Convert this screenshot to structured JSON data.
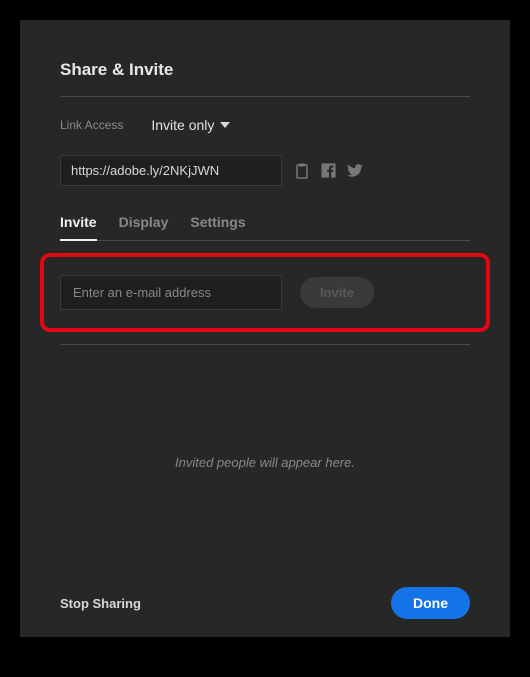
{
  "title": "Share & Invite",
  "linkAccess": {
    "label": "Link Access",
    "value": "Invite only"
  },
  "url": {
    "value": "https://adobe.ly/2NKjJWN"
  },
  "tabs": {
    "invite": "Invite",
    "display": "Display",
    "settings": "Settings"
  },
  "inviteForm": {
    "placeholder": "Enter an e-mail address",
    "buttonLabel": "Invite"
  },
  "emptyState": "Invited people will appear here.",
  "footer": {
    "stopSharing": "Stop Sharing",
    "done": "Done"
  }
}
